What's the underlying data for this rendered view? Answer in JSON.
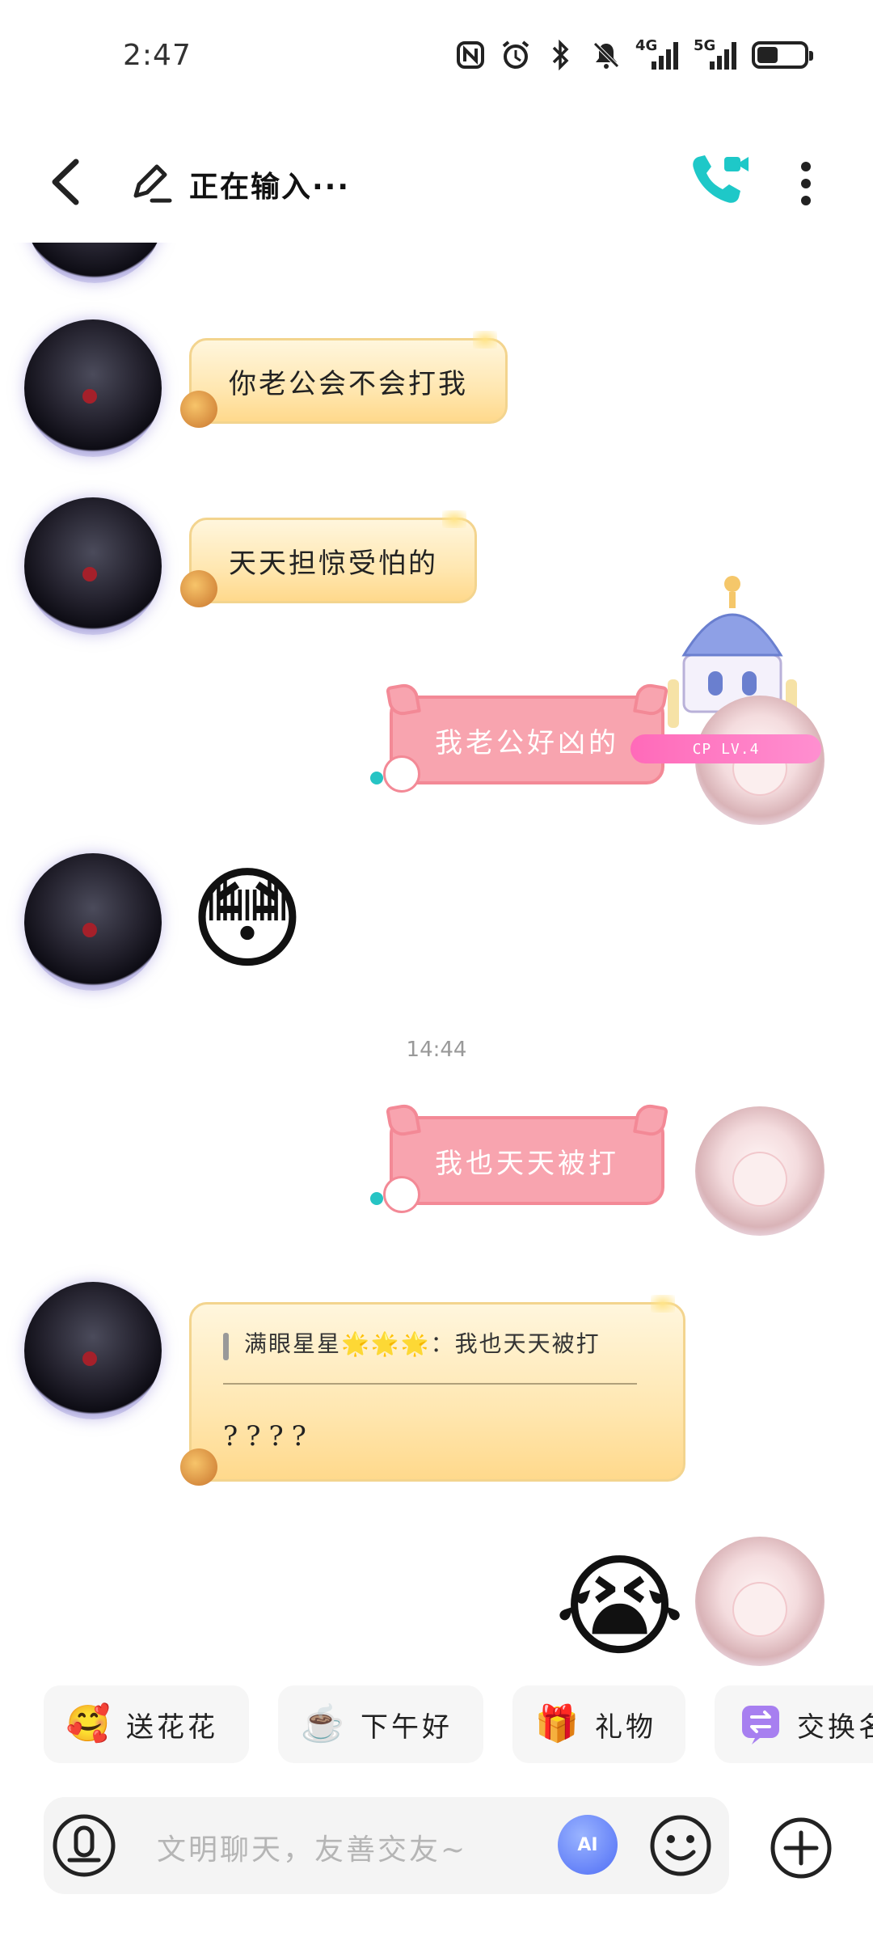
{
  "status_bar": {
    "time": "2:47",
    "net1": "4G",
    "net2": "5G",
    "battery_level": 0.45,
    "icons": [
      "nfc-icon",
      "alarm-icon",
      "bluetooth-icon",
      "mute-icon",
      "signal-4g-icon",
      "signal-5g-icon",
      "battery-icon"
    ]
  },
  "header": {
    "title": "正在输入···",
    "call_color": "#1ec8c8"
  },
  "messages": [
    {
      "side": "left",
      "text": "你老公会不会打我"
    },
    {
      "side": "left",
      "text": "天天担惊受怕的"
    },
    {
      "side": "right",
      "text": "我老公好凶的",
      "badge": "CP LV.4"
    },
    {
      "side": "left",
      "emoji": "😳"
    },
    {
      "side": "right",
      "text": "我也天天被打"
    },
    {
      "side": "left",
      "quote": "满眼星星🌟🌟🌟：我也天天被打",
      "text": "????"
    },
    {
      "side": "right",
      "emoji": "😭"
    }
  ],
  "timestamp": "14:44",
  "quick_actions": [
    {
      "label": "送花花",
      "icon": "flower-face-icon"
    },
    {
      "label": "下午好",
      "icon": "coffee-icon"
    },
    {
      "label": "礼物",
      "icon": "gift-icon"
    },
    {
      "label": "交换名",
      "icon": "exchange-icon"
    }
  ],
  "input": {
    "placeholder": "文明聊天，友善交友~",
    "ai_label": "AI"
  },
  "colors": {
    "left_bubble": "#ffe7b1",
    "right_bubble": "#f8a4af",
    "accent": "#26c4c4"
  }
}
